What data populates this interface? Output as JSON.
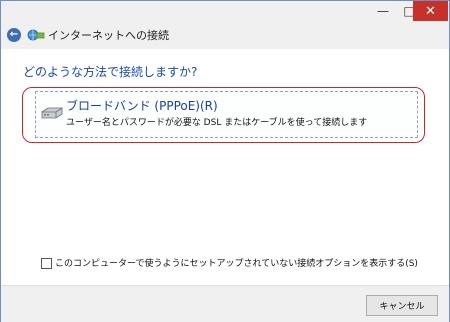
{
  "window": {
    "title": "インターネットへの接続"
  },
  "main": {
    "heading": "どのような方法で接続しますか?",
    "option": {
      "title": "ブロードバンド (PPPoE)(R)",
      "description": "ユーザー名とパスワードが必要な DSL またはケーブルを使って接続します"
    },
    "checkbox_label": "このコンピューターで使うようにセットアップされていない接続オプションを表示する(S)"
  },
  "footer": {
    "cancel_label": "キャンセル"
  },
  "icons": {
    "back": "back-arrow-icon",
    "network": "network-icon",
    "modem": "modem-icon"
  },
  "colors": {
    "accent": "#1b4aa8",
    "highlight_outline": "#c62828",
    "close_button": "#c7312b"
  }
}
